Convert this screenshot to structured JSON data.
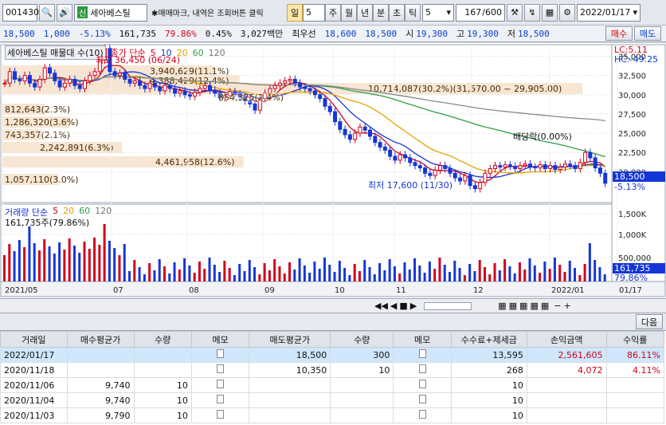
{
  "toolbar": {
    "code": "001430",
    "name": "세아베스틸",
    "badge": "신",
    "hint": "✱매매마크, 내역은 조회버튼 클릭",
    "periods": [
      "일",
      "5",
      "주",
      "월",
      "년",
      "분",
      "초",
      "틱"
    ],
    "interval": "5",
    "count": "167",
    "max": "/600",
    "date": "2022/01/17"
  },
  "quote": {
    "price": "18,500",
    "change": "1,000",
    "pct": "-5.13%",
    "volume": "161,735",
    "vol_ratio": "79.86%",
    "rate": "0.45%",
    "amount": "3,027백만",
    "best_label": "최우선",
    "ask": "18,600",
    "bid": "18,500",
    "open_label": "시",
    "open": "19,300",
    "high_label": "고",
    "high": "19,300",
    "low_label": "저",
    "low": "18,500",
    "buy": "매수",
    "sell": "매도"
  },
  "chart": {
    "title": "세아베스틸 매물대 수(10)",
    "ma_label": "종가 단순",
    "ma_periods": [
      "5",
      "10",
      "20",
      "60",
      "120"
    ],
    "vol_label": "거래량 단순",
    "vol_value": "161,735주(79.86%)",
    "lc": "LC:5.11",
    "hc": "HC:-49.25",
    "high_note": "최고 36,450 (06/24)",
    "low_note": "최저 17,600 (11/30)",
    "div_note": "배당락(0.00%)",
    "price_box": "18,500",
    "price_pct": "-5.13%",
    "vol_box": "161,735",
    "vol_pct": "79.86%",
    "y_ticks": [
      "35,000",
      "32,500",
      "30,000",
      "27,500",
      "25,000",
      "22,500",
      "20,000"
    ],
    "vol_ticks": [
      "1,500K",
      "1,000K",
      "500,000"
    ],
    "x_ticks": [
      "2021/05",
      "07",
      "08",
      "09",
      "10",
      "11",
      "12",
      "2022/01",
      "01/17"
    ],
    "profile": [
      {
        "label": "1,057,110(3.0%)",
        "w": 3.0
      },
      {
        "label": "4,461,958(12.6%)",
        "w": 12.6
      },
      {
        "label": "2,242,891(6.3%)",
        "w": 6.3
      },
      {
        "label": "743,357(2.1%)",
        "w": 2.1
      },
      {
        "label": "1,286,320(3.6%)",
        "w": 3.6
      },
      {
        "label": "812,643(2.3%)",
        "w": 2.3
      },
      {
        "label": "10,714,087(30.2%)(31,570.00 ~ 29,905.00)",
        "w": 30.2
      },
      {
        "label": "4,388,429(12.4%)",
        "w": 12.4
      },
      {
        "label": "3,940,629(11.1%)",
        "w": 11.1
      }
    ],
    "overlay_label": "854,325(2.4%)"
  },
  "panel": {
    "next": "다음"
  },
  "table": {
    "headers": [
      "거래일",
      "매수평균가",
      "수량",
      "메모",
      "매도평균가",
      "수량",
      "메모",
      "수수료+제세금",
      "손익금액",
      "수익률"
    ],
    "rows": [
      [
        "2022/01/17",
        "",
        "",
        "",
        "18,500",
        "300",
        "",
        "13,595",
        "2,561,605",
        "86.11%"
      ],
      [
        "2020/11/18",
        "",
        "",
        "",
        "10,350",
        "10",
        "",
        "268",
        "4,072",
        "4.11%"
      ],
      [
        "2020/11/06",
        "9,740",
        "10",
        "",
        "",
        "",
        "",
        "10",
        "",
        ""
      ],
      [
        "2020/11/04",
        "9,740",
        "10",
        "",
        "",
        "",
        "",
        "10",
        "",
        ""
      ],
      [
        "2020/11/03",
        "9,790",
        "10",
        "",
        "",
        "",
        "",
        "10",
        "",
        ""
      ]
    ]
  }
}
